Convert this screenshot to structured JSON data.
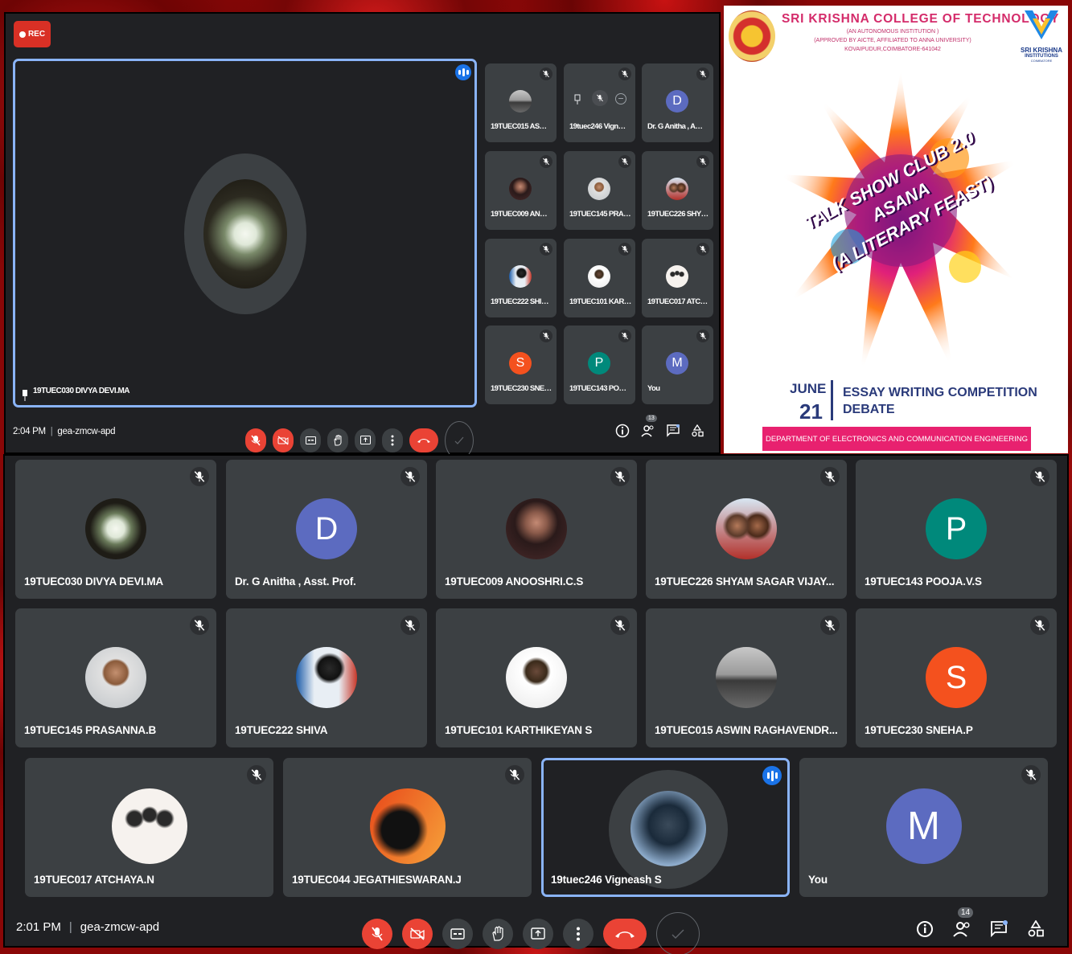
{
  "top_meeting": {
    "rec_label": "REC",
    "pinned_name": "19TUEC030 DIVYA DEVI.MA",
    "time": "2:04 PM",
    "separator": "|",
    "meeting_code": "gea-zmcw-apd",
    "participant_count": "13",
    "thumbnails": [
      {
        "label": "19TUEC015 AS…",
        "avatar": "photo-gray"
      },
      {
        "label": "19tuec246 Vign…",
        "avatar": "controls"
      },
      {
        "label": "Dr. G Anitha , A…",
        "avatar": "D",
        "color": "#5c6bc0"
      },
      {
        "label": "19TUEC009 AN…",
        "avatar": "photo-girl"
      },
      {
        "label": "19TUEC145 PRA…",
        "avatar": "photo-boy"
      },
      {
        "label": "19TUEC226 SHY…",
        "avatar": "photo-pair"
      },
      {
        "label": "19TUEC222 SHI…",
        "avatar": "photo-stage"
      },
      {
        "label": "19TUEC101 KAR…",
        "avatar": "photo-dark"
      },
      {
        "label": "19TUEC017 ATC…",
        "avatar": "photo-cartoon"
      },
      {
        "label": "19TUEC230 SNE…",
        "avatar": "S",
        "color": "#f4511e"
      },
      {
        "label": "19TUEC143 PO…",
        "avatar": "P",
        "color": "#00897b"
      },
      {
        "label": "You",
        "avatar": "M",
        "color": "#5c6bc0"
      }
    ]
  },
  "poster": {
    "college": "SRI KRISHNA COLLEGE OF TECHNOLOGY",
    "sub1": "(AN AUTONOMOUS INSTITUTION )",
    "sub2": "(APPROVED BY AICTE, AFFILIATED TO ANNA UNIVERSITY)",
    "sub3": "KOVAIPUDUR,COIMBATORE-641042",
    "logo_text1": "SRI KRISHNA",
    "logo_text2": "INSTITUTIONS",
    "logo_text3": "COIMBATORE",
    "line1": "TALK SHOW CLUB 2.0",
    "line2": "ASANA",
    "line3": "(A LITERARY FEAST)",
    "month": "JUNE",
    "day": "21",
    "event1": "ESSAY WRITING COMPETITION",
    "event2": "DEBATE",
    "department": "DEPARTMENT OF ELECTRONICS AND COMMUNICATION ENGINEERING"
  },
  "bottom_meeting": {
    "time": "2:01 PM",
    "separator": "|",
    "meeting_code": "gea-zmcw-apd",
    "participant_count": "14",
    "tiles": [
      {
        "name": "19TUEC030 DIVYA DEVI.MA",
        "avatar": "photo-flower"
      },
      {
        "name": "Dr. G Anitha , Asst. Prof.",
        "avatar": "D",
        "color": "#5c6bc0"
      },
      {
        "name": "19TUEC009 ANOOSHRI.C.S",
        "avatar": "photo-girl"
      },
      {
        "name": "19TUEC226 SHYAM SAGAR VIJAY...",
        "avatar": "photo-pair"
      },
      {
        "name": "19TUEC143 POOJA.V.S",
        "avatar": "P",
        "color": "#00897b"
      },
      {
        "name": "19TUEC145 PRASANNA.B",
        "avatar": "photo-boy"
      },
      {
        "name": "19TUEC222 SHIVA",
        "avatar": "photo-stage"
      },
      {
        "name": "19TUEC101 KARTHIKEYAN S",
        "avatar": "photo-dark"
      },
      {
        "name": "19TUEC015 ASWIN RAGHAVENDR...",
        "avatar": "photo-gray"
      },
      {
        "name": "19TUEC230 SNEHA.P",
        "avatar": "S",
        "color": "#f4511e"
      },
      {
        "name": "19TUEC017 ATCHAYA.N",
        "avatar": "photo-cartoon"
      },
      {
        "name": "19TUEC044 JEGATHIESWARAN.J",
        "avatar": "photo-orange"
      },
      {
        "name": "19tuec246 Vigneash S",
        "avatar": "photo-shiva",
        "speaking": true
      },
      {
        "name": "You",
        "avatar": "M",
        "color": "#5c6bc0"
      }
    ]
  },
  "colors": {
    "accent": "#8ab4f8",
    "hangup": "#ea4335",
    "tile": "#3c4043",
    "bg": "#202124"
  }
}
